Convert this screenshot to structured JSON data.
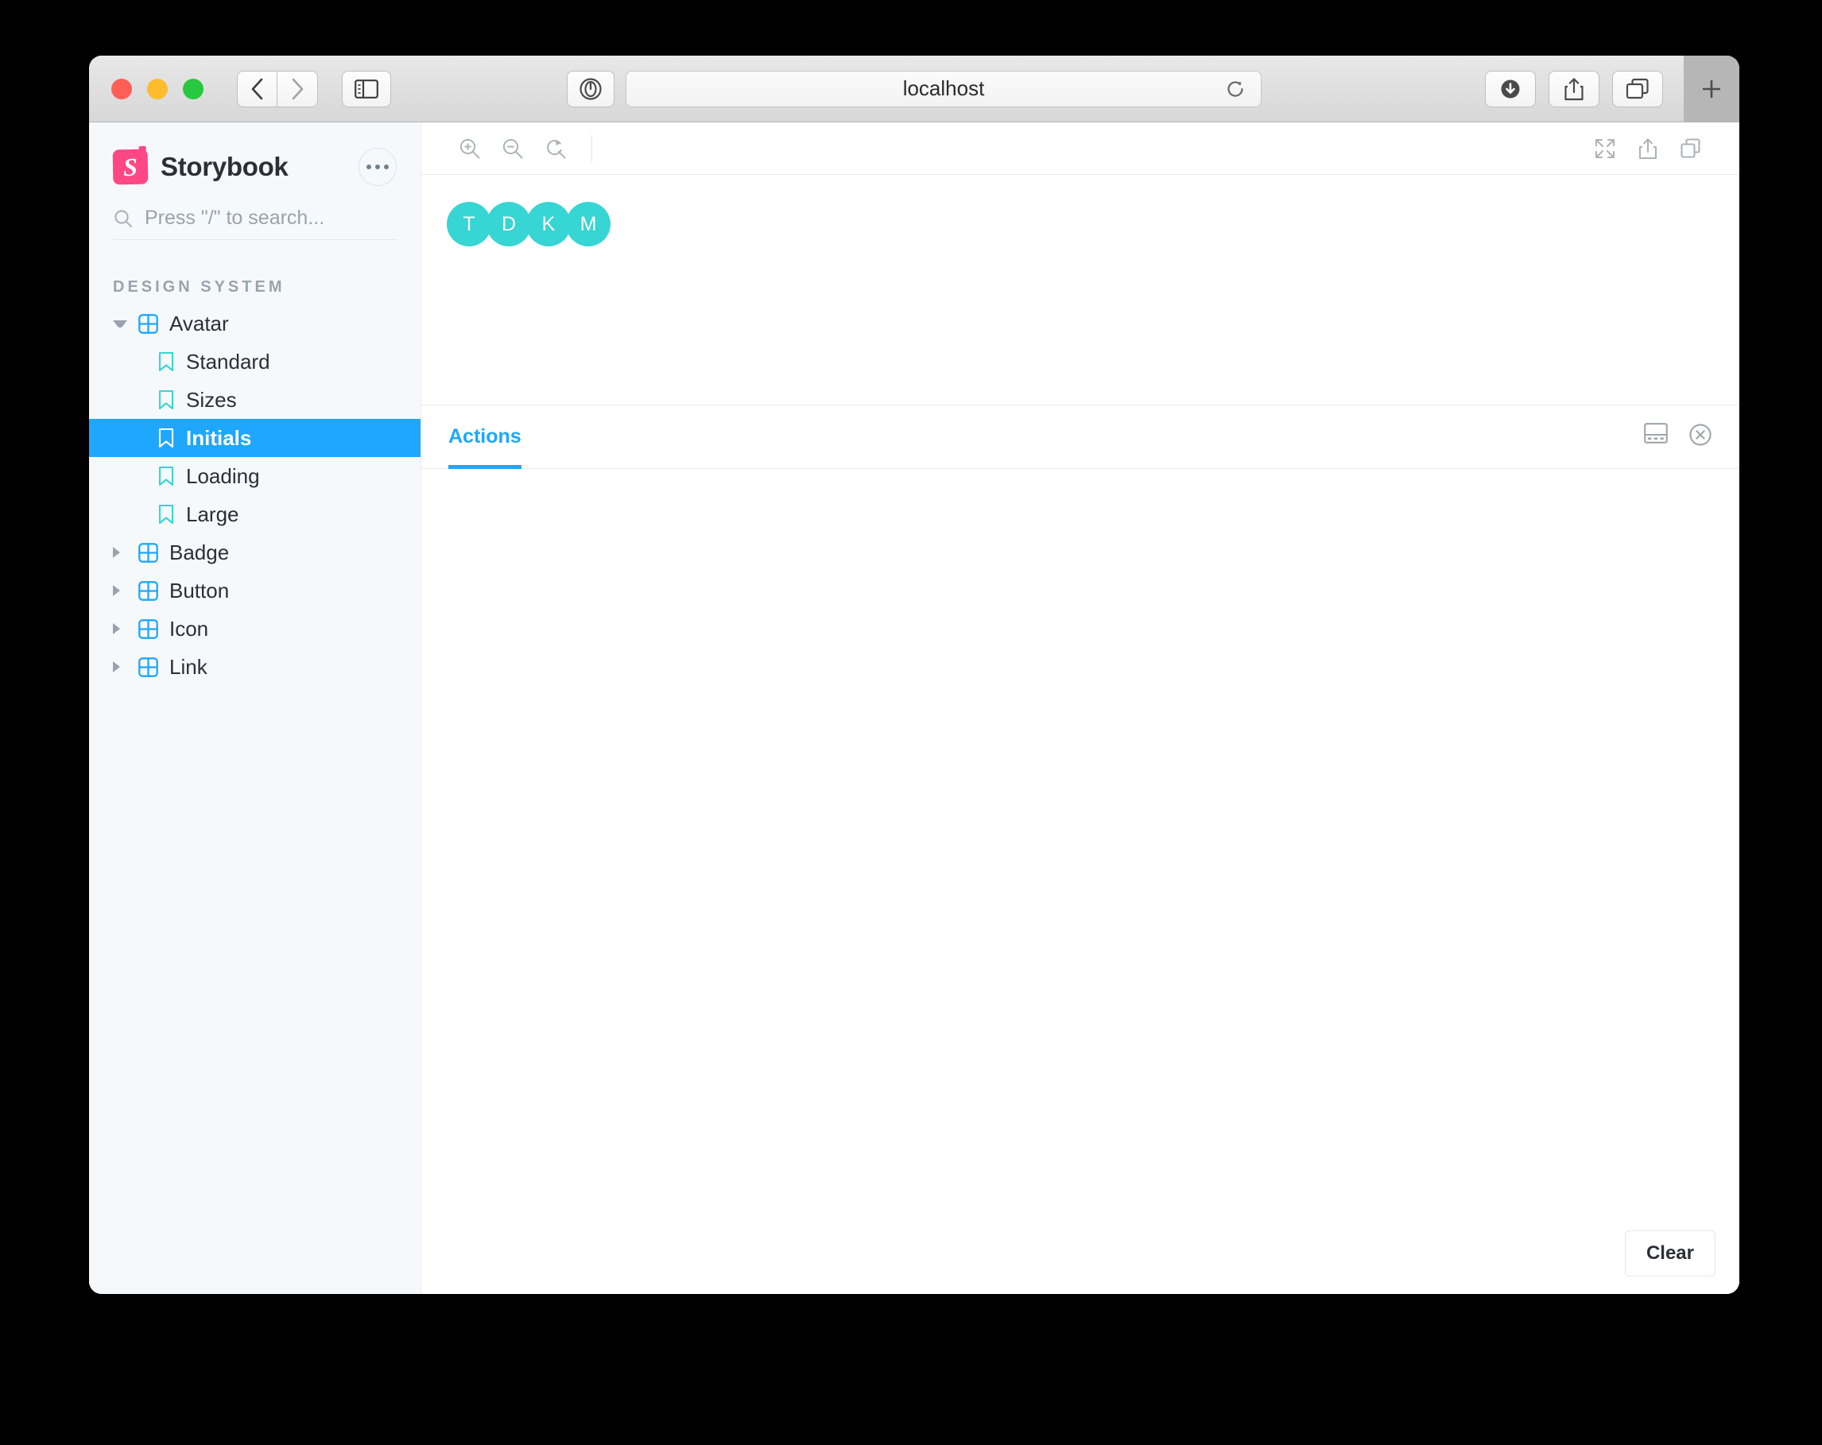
{
  "browser": {
    "url": "localhost",
    "controls": {
      "close": "close-window",
      "minimize": "minimize-window",
      "maximize": "maximize-window",
      "back": "back",
      "forward": "forward",
      "sidebar": "show-sidebar",
      "privacy": "privacy-report",
      "reload": "reload-page",
      "downloads": "downloads",
      "share": "share",
      "tab_overview": "tab-overview",
      "new_tab": "+"
    }
  },
  "storybook": {
    "brand": "Storybook",
    "menu_label": "menu",
    "search": {
      "placeholder": "Press \"/\" to search..."
    },
    "section_title": "DESIGN SYSTEM",
    "tree": [
      {
        "label": "Avatar",
        "type": "component",
        "expanded": true,
        "level": 0
      },
      {
        "label": "Standard",
        "type": "story",
        "selected": false,
        "level": 1
      },
      {
        "label": "Sizes",
        "type": "story",
        "selected": false,
        "level": 1
      },
      {
        "label": "Initials",
        "type": "story",
        "selected": true,
        "level": 1
      },
      {
        "label": "Loading",
        "type": "story",
        "selected": false,
        "level": 1
      },
      {
        "label": "Large",
        "type": "story",
        "selected": false,
        "level": 1
      },
      {
        "label": "Badge",
        "type": "component",
        "expanded": false,
        "level": 0
      },
      {
        "label": "Button",
        "type": "component",
        "expanded": false,
        "level": 0
      },
      {
        "label": "Icon",
        "type": "component",
        "expanded": false,
        "level": 0
      },
      {
        "label": "Link",
        "type": "component",
        "expanded": false,
        "level": 0
      }
    ],
    "preview_toolbar": {
      "zoom_in": "zoom-in",
      "zoom_out": "zoom-out",
      "zoom_reset": "reset-zoom",
      "fullscreen": "go-fullscreen",
      "open_new_tab": "open-canvas-in-new-tab",
      "copy": "copy-canvas-link"
    },
    "canvas": {
      "avatars": [
        {
          "initials": "T",
          "color": "#37d5d3"
        },
        {
          "initials": "D",
          "color": "#37d5d3"
        },
        {
          "initials": "K",
          "color": "#37d5d3"
        },
        {
          "initials": "M",
          "color": "#37d5d3"
        }
      ]
    },
    "panel": {
      "tabs": [
        {
          "label": "Actions",
          "active": true
        }
      ],
      "position_toggle": "change-panel-position",
      "close": "close-panel",
      "clear_label": "Clear"
    },
    "colors": {
      "accent": "#1ea7fd",
      "brand": "#ff4785",
      "avatar": "#37d5d3",
      "sidebar_bg": "#f6f9fc"
    }
  }
}
